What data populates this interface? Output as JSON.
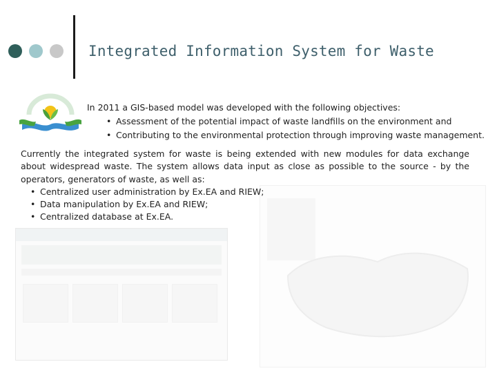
{
  "title": "Integrated Information System for Waste",
  "colors": {
    "dot1": "#2f5f5a",
    "dot2": "#9fc8cc",
    "dot3": "#c8c8c8",
    "title": "#3e5f6b"
  },
  "logo": {
    "icon": "eco-logo-icon"
  },
  "intro": {
    "lead": "In 2011 a GIS-based model was developed with the following objectives:",
    "bullets": [
      "Assessment of the potential impact of waste landfills on the environment and",
      "Contributing to the environmental protection through improving waste management."
    ]
  },
  "body": {
    "paragraph": "Currently the integrated system for waste is being extended with new modules for data exchange about widespread waste. The system allows data input as close as possible to the source - by the operators, generators of waste, as well as:",
    "bullets": [
      "Centralized user administration by Ex.EA and RIEW;",
      "Data manipulation by Ex.EA and RIEW;",
      "Centralized database at Ex.EA."
    ]
  }
}
